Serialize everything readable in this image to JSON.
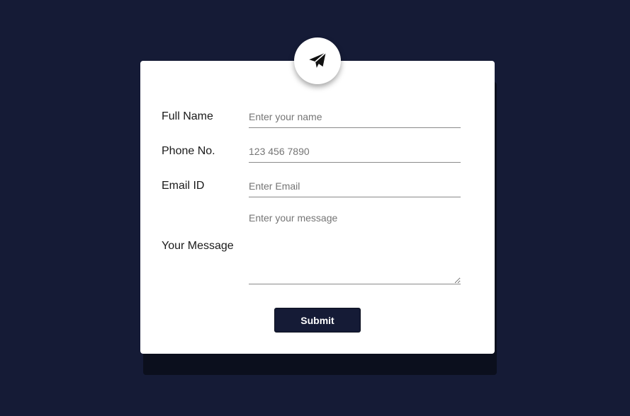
{
  "form": {
    "icon": "paper-plane-icon",
    "full_name": {
      "label": "Full Name",
      "placeholder": "Enter your name"
    },
    "phone": {
      "label": "Phone No.",
      "placeholder": "123 456 7890"
    },
    "email": {
      "label": "Email ID",
      "placeholder": "Enter Email"
    },
    "message": {
      "label": "Your Message",
      "placeholder": "Enter your message"
    },
    "submit_label": "Submit"
  },
  "colors": {
    "background": "#151b36",
    "card": "#ffffff",
    "button": "#151b36",
    "shadow": "#0b0f1d"
  }
}
